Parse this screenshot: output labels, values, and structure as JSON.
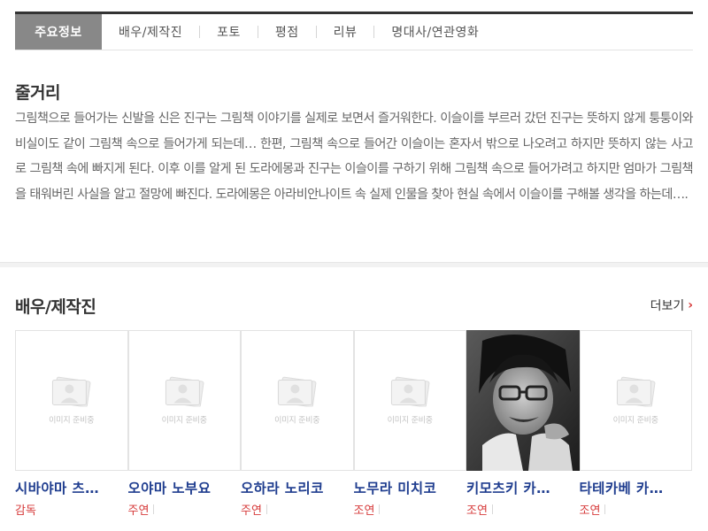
{
  "tabs": [
    {
      "label": "주요정보",
      "active": true
    },
    {
      "label": "배우/제작진"
    },
    {
      "label": "포토"
    },
    {
      "label": "평점"
    },
    {
      "label": "리뷰"
    },
    {
      "label": "명대사/연관영화"
    }
  ],
  "synopsis": {
    "title": "줄거리",
    "text": "그림책으로 들어가는 신발을 신은 진구는 그림책 이야기를 실제로 보면서 즐거워한다. 이슬이를 부르러 갔던 진구는 뜻하지 않게 퉁퉁이와 비실이도 같이 그림책 속으로 들어가게 되는데… 한편, 그림책 속으로 들어간 이슬이는 혼자서 밖으로 나오려고 하지만 뜻하지 않는 사고로 그림책 속에 빠지게 된다. 이후 이를 알게 된 도라에몽과 진구는 이슬이를 구하기 위해 그림책 속으로 들어가려고 하지만 엄마가 그림책을 태워버린 사실을 알고 절망에 빠진다. 도라에몽은 아라비안나이트 속 실제 인물을 찾아 현실 속에서 이슬이를 구해볼 생각을 하는데…."
  },
  "cast": {
    "title": "배우/제작진",
    "more_label": "더보기",
    "placeholder_text": "이미지 준비중",
    "members": [
      {
        "name": "시바야마 츠…",
        "role": "감독",
        "has_photo": false
      },
      {
        "name": "오야마 노부요",
        "role": "주연",
        "has_photo": false
      },
      {
        "name": "오하라 노리코",
        "role": "주연",
        "has_photo": false
      },
      {
        "name": "노무라 미치코",
        "role": "조연",
        "has_photo": false
      },
      {
        "name": "키모츠키 카…",
        "role": "조연",
        "has_photo": true
      },
      {
        "name": "타테카베 카…",
        "role": "조연",
        "has_photo": false
      }
    ]
  },
  "colors": {
    "active_tab_bg": "#888888",
    "name_color": "#1f3d8f",
    "role_color": "#d63a3a"
  }
}
